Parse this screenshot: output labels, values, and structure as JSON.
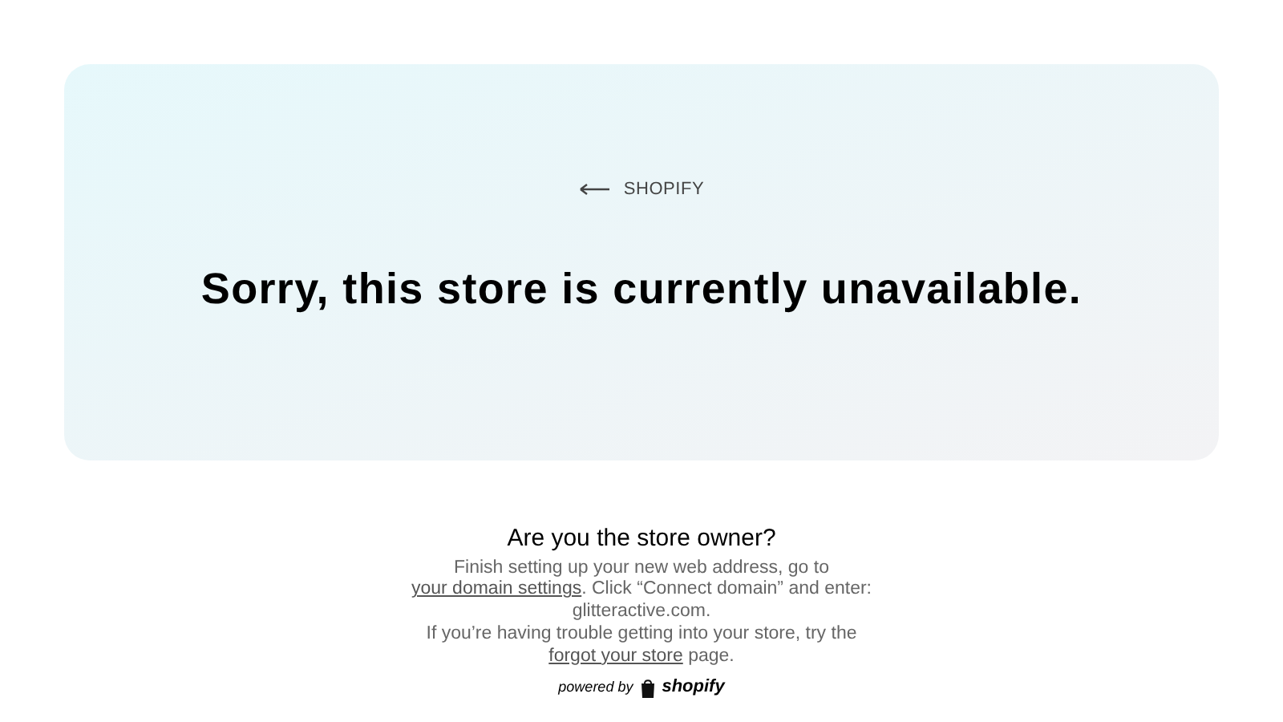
{
  "banner": {
    "back_link": "SHOPIFY",
    "heading": "Sorry, this store is currently unavailable."
  },
  "owner_section": {
    "heading": "Are you the store owner?",
    "paragraphs": [
      [
        {
          "kind": "text",
          "text": "Finish setting up your new web address, go to "
        },
        {
          "kind": "link",
          "text": "your domain settings"
        },
        {
          "kind": "text",
          "text": ". Click “Connect domain” and enter: glitteractive.com."
        }
      ],
      [
        {
          "kind": "text",
          "text": "If you’re having trouble getting into your store, try the "
        },
        {
          "kind": "link",
          "text": "forgot your store"
        },
        {
          "kind": "text",
          "text": " page."
        }
      ]
    ]
  },
  "footer": {
    "powered_by": "powered by",
    "brand": "shopify"
  }
}
